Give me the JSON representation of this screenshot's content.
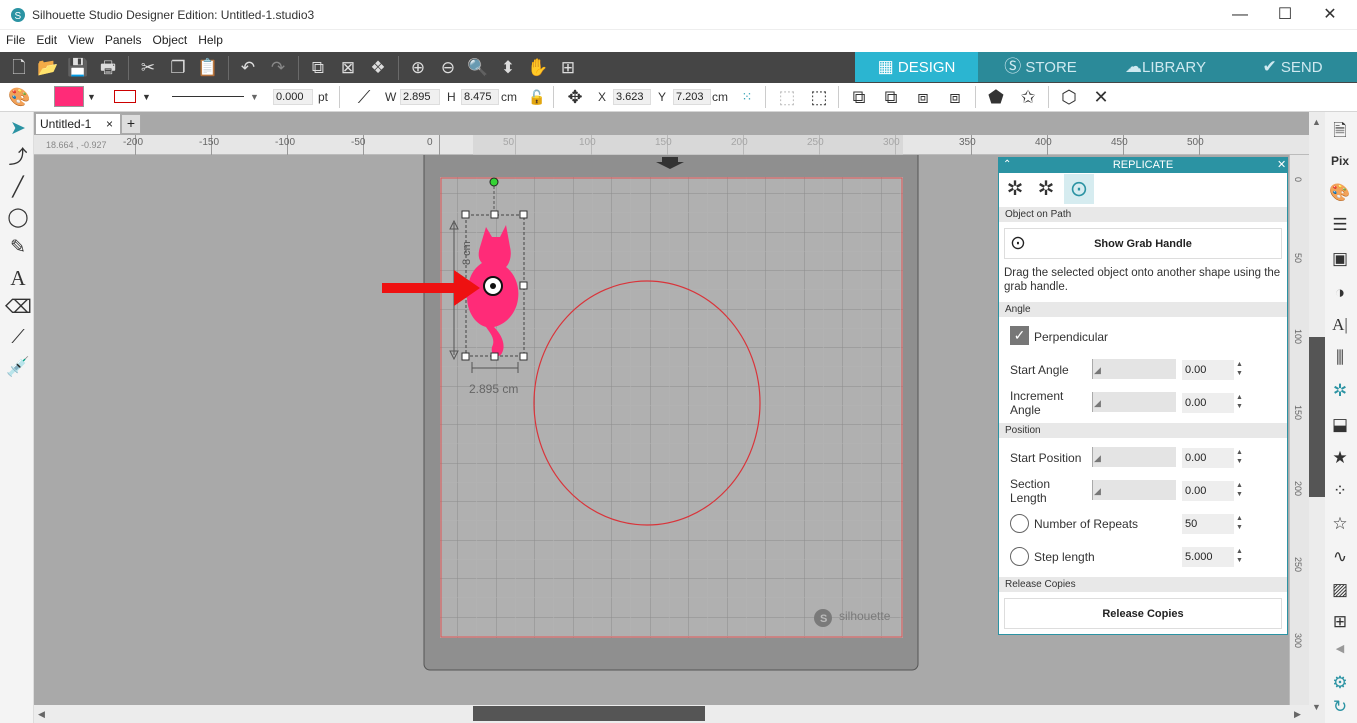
{
  "app": {
    "title": "Silhouette Studio Designer Edition: Untitled-1.studio3"
  },
  "window": {
    "minimize": "—",
    "maximize": "☐",
    "close": "✕"
  },
  "menu": [
    "File",
    "Edit",
    "View",
    "Panels",
    "Object",
    "Help"
  ],
  "nav_tabs": [
    {
      "label": "DESIGN",
      "icon": "grid-icon",
      "active": true
    },
    {
      "label": "STORE",
      "icon": "store-icon",
      "active": false
    },
    {
      "label": "LIBRARY",
      "icon": "cloud-icon",
      "active": false
    },
    {
      "label": "SEND",
      "icon": "check-icon",
      "active": false
    }
  ],
  "props": {
    "line_width": "0.000",
    "line_unit": "pt",
    "w_label": "W",
    "w_value": "2.895",
    "h_label": "H",
    "h_value": "8.475",
    "size_unit": "cm",
    "x_label": "X",
    "x_value": "3.623",
    "y_label": "Y",
    "y_value": "7.203",
    "pos_unit": "cm",
    "fill_color": "#ff2b78",
    "line_color": "#cc0000"
  },
  "doc_tab": {
    "name": "Untitled-1",
    "close": "×",
    "add": "+"
  },
  "ruler": {
    "coords": "18.664 , -0.927",
    "h_ticks": [
      "-200",
      "-150",
      "-100",
      "-50",
      "0",
      "50",
      "100",
      "150",
      "200",
      "250",
      "300",
      "350",
      "400",
      "450",
      "500"
    ],
    "v_ticks": [
      "0",
      "50",
      "100",
      "150",
      "200",
      "250",
      "300"
    ]
  },
  "canvas": {
    "width_dim": "2.895 cm",
    "height_dim": "8",
    "height_unit": "cm",
    "watermark": "silhouette"
  },
  "panel": {
    "title": "REPLICATE",
    "sections": {
      "object_on_path": "Object on Path",
      "angle": "Angle",
      "position": "Position",
      "release": "Release Copies"
    },
    "show_grab_handle": "Show Grab Handle",
    "description": "Drag the selected object onto another shape using the grab handle.",
    "perpendicular": "Perpendicular",
    "start_angle": {
      "label": "Start Angle",
      "value": "0.00"
    },
    "increment_angle": {
      "label": "Increment Angle",
      "value": "0.00"
    },
    "start_position": {
      "label": "Start Position",
      "value": "0.00"
    },
    "section_length": {
      "label": "Section Length",
      "value": "0.00"
    },
    "num_repeats": {
      "label": "Number of Repeats",
      "value": "50"
    },
    "step_length": {
      "label": "Step length",
      "value": "5.000"
    },
    "release_button": "Release Copies"
  }
}
